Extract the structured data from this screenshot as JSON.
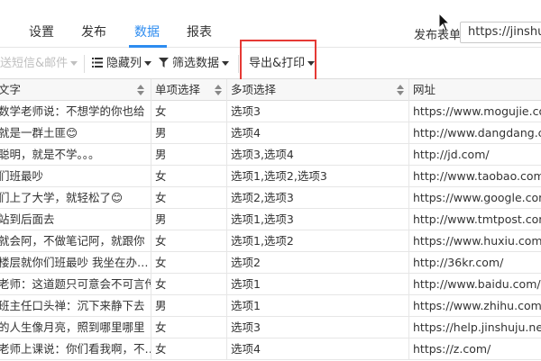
{
  "nav": {
    "tabs": [
      {
        "label": "设置"
      },
      {
        "label": "发布"
      },
      {
        "label": "数据"
      },
      {
        "label": "报表"
      }
    ],
    "publish_label": "发布表单",
    "publish_url": "https://jinshuju"
  },
  "toolbar": {
    "send": "送短信&邮件",
    "hide_columns": "隐藏列",
    "filter": "筛选数据",
    "export": "导出&打印"
  },
  "table": {
    "columns": [
      "文字",
      "单项选择",
      "多项选择",
      "网址"
    ],
    "rows": [
      [
        "数学老师说：不想学的你也给",
        "女",
        "选项3",
        "https://www.mogujie.com"
      ],
      [
        "就是一群土匪😊",
        "男",
        "选项4",
        "http://www.dangdang.com"
      ],
      [
        "聪明，就是不学。。。",
        "男",
        "选项3,选项4",
        "http://jd.com/"
      ],
      [
        "们班最吵",
        "女",
        "选项1,选项2,选项3",
        "http://www.taobao.com"
      ],
      [
        "们上了大学，就轻松了😊",
        "女",
        "选项2,选项3",
        "https://www.google.com"
      ],
      [
        " 站到后面去",
        "男",
        "选项1,选项3",
        "http://www.tmtpost.com"
      ],
      [
        "就会阿，不做笔记阿，就跟你",
        "女",
        "选项1,选项2",
        "https://www.huxiu.com/"
      ],
      [
        "楼层就你们班最吵 我坐在办…",
        "女",
        "选项2",
        "http://36kr.com/"
      ],
      [
        "老师：这道题只可意会不可言传",
        "女",
        "选项1",
        "http://www.baidu.com/"
      ],
      [
        "班主任口头禅：沉下来静下去",
        "男",
        "选项1",
        "https://www.zhihu.com/"
      ],
      [
        "的人生像月亮，照到哪里哪里",
        "女",
        "选项3",
        "https://help.jinshuju.net"
      ],
      [
        "老师上课说：你们看我啊，不…",
        "女",
        "选项4",
        "https://z.com/"
      ]
    ]
  }
}
